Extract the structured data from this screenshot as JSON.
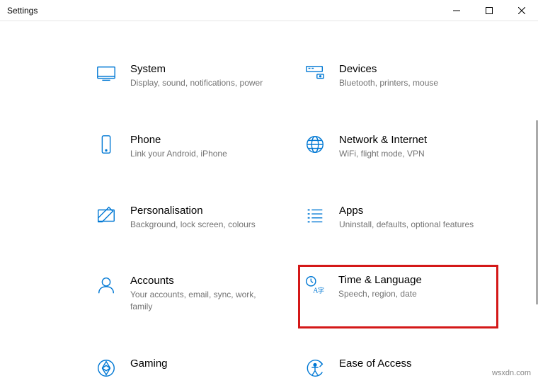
{
  "window": {
    "title": "Settings"
  },
  "categories": [
    {
      "id": "system",
      "title": "System",
      "desc": "Display, sound, notifications, power",
      "highlighted": false
    },
    {
      "id": "devices",
      "title": "Devices",
      "desc": "Bluetooth, printers, mouse",
      "highlighted": false
    },
    {
      "id": "phone",
      "title": "Phone",
      "desc": "Link your Android, iPhone",
      "highlighted": false
    },
    {
      "id": "network",
      "title": "Network & Internet",
      "desc": "WiFi, flight mode, VPN",
      "highlighted": false
    },
    {
      "id": "personalisation",
      "title": "Personalisation",
      "desc": "Background, lock screen, colours",
      "highlighted": false
    },
    {
      "id": "apps",
      "title": "Apps",
      "desc": "Uninstall, defaults, optional features",
      "highlighted": false
    },
    {
      "id": "accounts",
      "title": "Accounts",
      "desc": "Your accounts, email, sync, work, family",
      "highlighted": false
    },
    {
      "id": "time-language",
      "title": "Time & Language",
      "desc": "Speech, region, date",
      "highlighted": true
    },
    {
      "id": "gaming",
      "title": "Gaming",
      "desc": "",
      "highlighted": false
    },
    {
      "id": "ease-of-access",
      "title": "Ease of Access",
      "desc": "",
      "highlighted": false
    }
  ],
  "watermark": "wsxdn.com"
}
